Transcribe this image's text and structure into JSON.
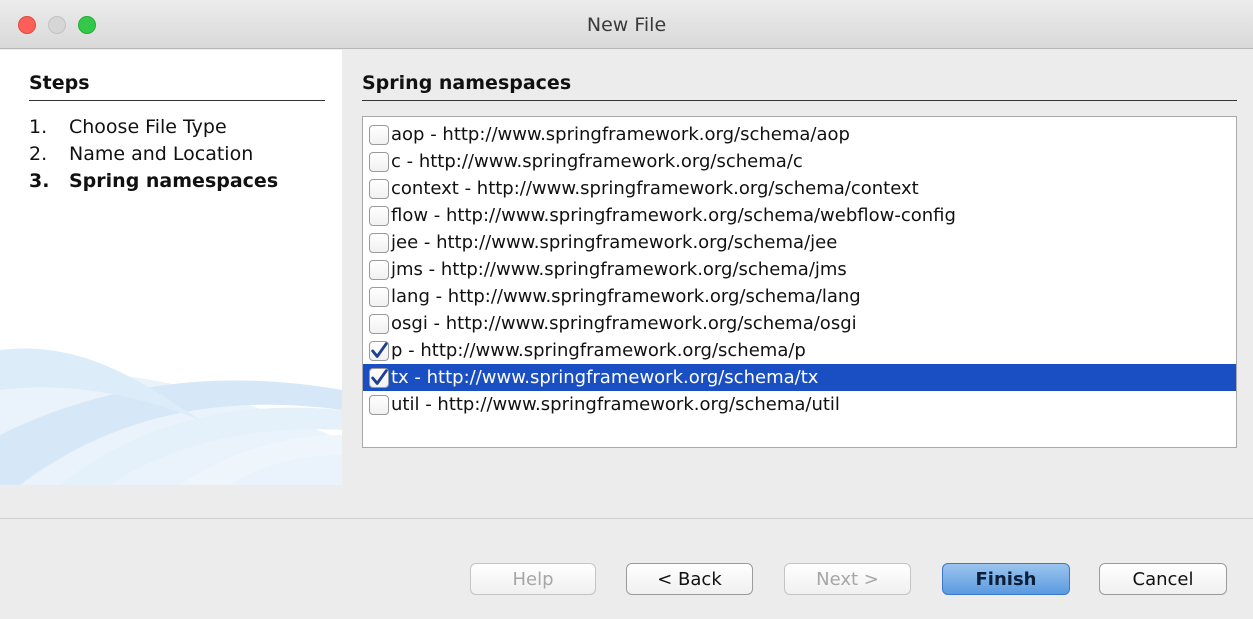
{
  "window": {
    "title": "New File"
  },
  "steps": {
    "header": "Steps",
    "items": [
      {
        "num": "1.",
        "label": "Choose File Type",
        "current": false
      },
      {
        "num": "2.",
        "label": "Name and Location",
        "current": false
      },
      {
        "num": "3.",
        "label": "Spring namespaces",
        "current": true
      }
    ]
  },
  "content": {
    "header": "Spring namespaces",
    "namespaces": [
      {
        "label": "aop - http://www.springframework.org/schema/aop",
        "checked": false,
        "selected": false
      },
      {
        "label": "c - http://www.springframework.org/schema/c",
        "checked": false,
        "selected": false
      },
      {
        "label": "context - http://www.springframework.org/schema/context",
        "checked": false,
        "selected": false
      },
      {
        "label": "flow - http://www.springframework.org/schema/webflow-config",
        "checked": false,
        "selected": false
      },
      {
        "label": "jee - http://www.springframework.org/schema/jee",
        "checked": false,
        "selected": false
      },
      {
        "label": "jms - http://www.springframework.org/schema/jms",
        "checked": false,
        "selected": false
      },
      {
        "label": "lang - http://www.springframework.org/schema/lang",
        "checked": false,
        "selected": false
      },
      {
        "label": "osgi - http://www.springframework.org/schema/osgi",
        "checked": false,
        "selected": false
      },
      {
        "label": "p - http://www.springframework.org/schema/p",
        "checked": true,
        "selected": false
      },
      {
        "label": "tx - http://www.springframework.org/schema/tx",
        "checked": true,
        "selected": true
      },
      {
        "label": "util - http://www.springframework.org/schema/util",
        "checked": false,
        "selected": false
      }
    ]
  },
  "buttons": {
    "help": "Help",
    "back": "< Back",
    "next": "Next >",
    "finish": "Finish",
    "cancel": "Cancel"
  },
  "colors": {
    "selection": "#1a4fc4",
    "checkmark": "#1f3f8f",
    "default_button": "#5a9be0",
    "close": "#fc5f57",
    "maximize": "#34c84a"
  }
}
